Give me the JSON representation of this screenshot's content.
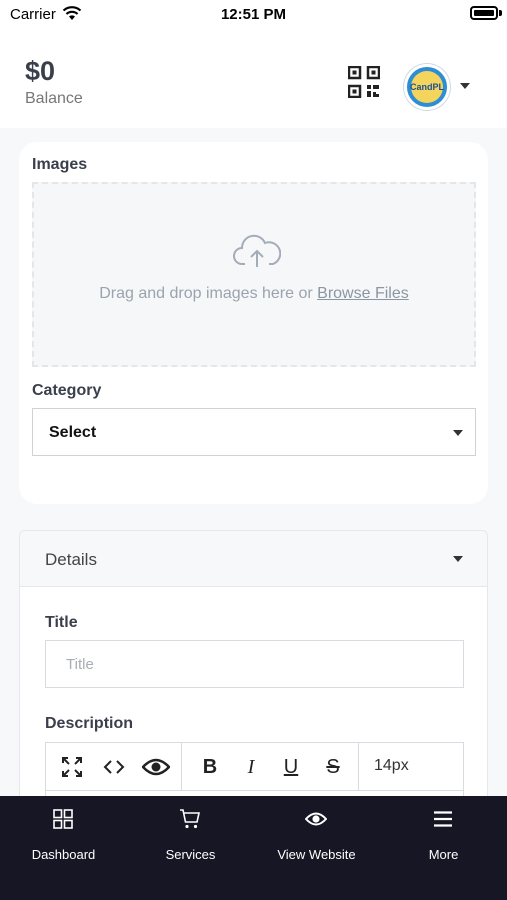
{
  "status_bar": {
    "carrier": "Carrier",
    "time": "12:51 PM"
  },
  "header": {
    "balance_amount": "$0",
    "balance_label": "Balance",
    "avatar_text": "CandPL"
  },
  "images_section": {
    "label": "Images",
    "drop_text": "Drag and drop images here or",
    "browse_label": "Browse Files"
  },
  "category": {
    "label": "Category",
    "selected": "Select"
  },
  "details": {
    "header": "Details",
    "title_label": "Title",
    "title_placeholder": "Title",
    "description_label": "Description",
    "font_size": "14px",
    "bold": "B",
    "italic": "I",
    "underline": "U",
    "strike": "S"
  },
  "tabbar": {
    "items": [
      {
        "label": "Dashboard",
        "icon": "grid-icon"
      },
      {
        "label": "Services",
        "icon": "cart-icon"
      },
      {
        "label": "View Website",
        "icon": "eye-icon"
      },
      {
        "label": "More",
        "icon": "menu-icon"
      }
    ]
  }
}
